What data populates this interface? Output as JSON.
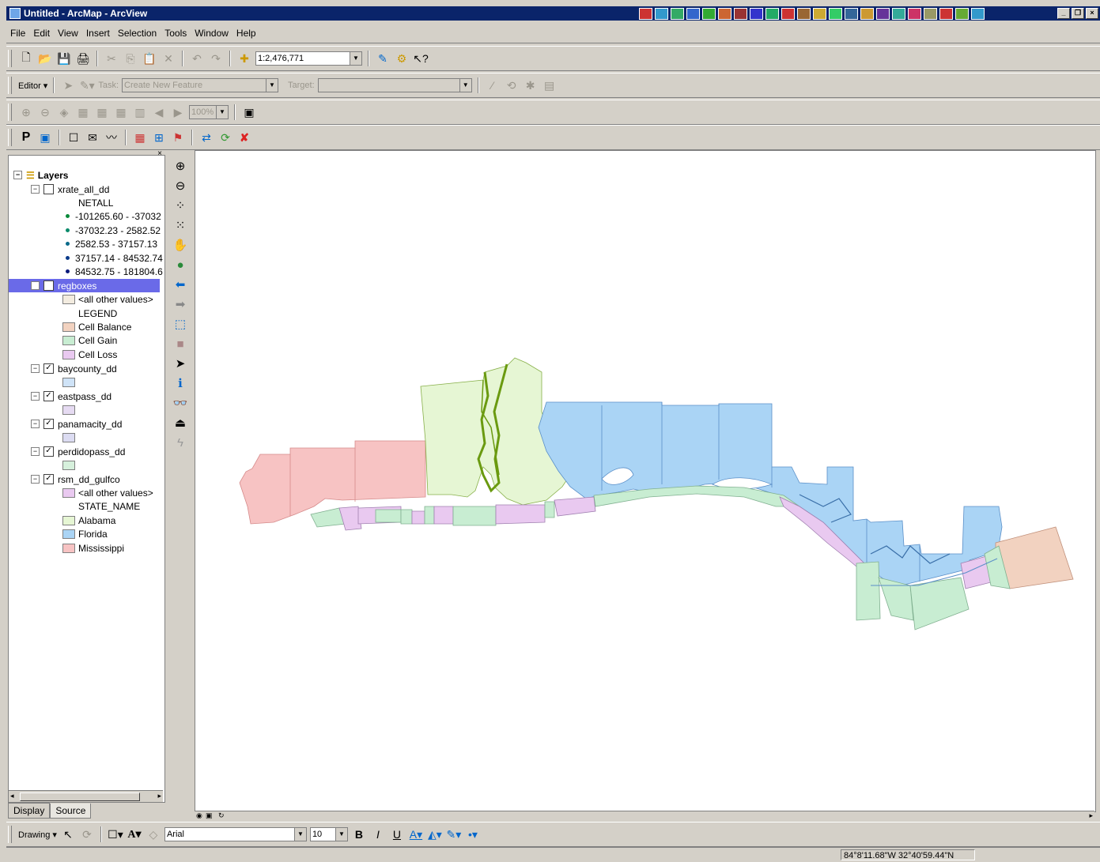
{
  "window": {
    "title": "Untitled - ArcMap - ArcView"
  },
  "menu": [
    "File",
    "Edit",
    "View",
    "Insert",
    "Selection",
    "Tools",
    "Window",
    "Help"
  ],
  "standard_toolbar": {
    "scale": "1:2,476,771"
  },
  "editor_toolbar": {
    "editor_label": "Editor ▾",
    "task_label": "Task:",
    "task_value": "Create New Feature",
    "target_label": "Target:",
    "target_value": ""
  },
  "georef_toolbar": {
    "zoom_value": "100%"
  },
  "custom_toolbar": {
    "p_label": "P"
  },
  "toc": {
    "root": "Layers",
    "layers": [
      {
        "name": "xrate_all_dd",
        "field": "NETALL",
        "classes": [
          "-101265.60 - -37032",
          "-37032.23 - 2582.52",
          "2582.53 - 37157.13",
          "37157.14 - 84532.74",
          "84532.75 - 181804.6"
        ]
      },
      {
        "name": "regboxes",
        "other": "<all other values>",
        "field": "LEGEND",
        "classes": [
          "Cell Balance",
          "Cell Gain",
          "Cell Loss"
        ]
      },
      {
        "name": "baycounty_dd"
      },
      {
        "name": "eastpass_dd"
      },
      {
        "name": "panamacity_dd"
      },
      {
        "name": "perdidopass_dd"
      },
      {
        "name": "rsm_dd_gulfco",
        "other": "<all other values>",
        "field": "STATE_NAME",
        "classes": [
          "Alabama",
          "Florida",
          "Mississippi"
        ]
      }
    ],
    "tabs": [
      "Display",
      "Source"
    ]
  },
  "colors": {
    "florida": "#aad4f5",
    "alabama": "#e6f6d4",
    "mississippi": "#f7c3c3",
    "cell_balance": "#f2d2c0",
    "cell_gain": "#c8edd2",
    "cell_loss": "#e9c9f0",
    "selection": "#6a6ae8"
  },
  "drawing_toolbar": {
    "label": "Drawing ▾",
    "font": "Arial",
    "size": "10",
    "bold": "B",
    "italic": "I",
    "underline": "U"
  },
  "status": {
    "coords": "84°8'11.68\"W  32°40'59.44\"N"
  }
}
